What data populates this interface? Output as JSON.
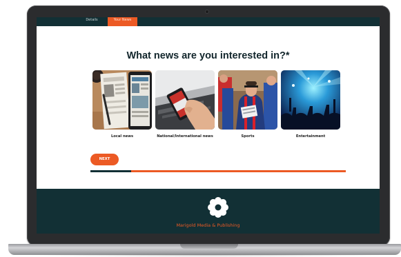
{
  "nav": {
    "item_1": "Details",
    "item_2": "Your News"
  },
  "form": {
    "question": "What news are you interested in?*",
    "options": [
      {
        "label": "Local news",
        "image": "newspapers-photo"
      },
      {
        "label": "National/International news",
        "image": "phone-news-photo"
      },
      {
        "label": "Sports",
        "image": "sports-coach-photo"
      },
      {
        "label": "Entertainment",
        "image": "concert-crowd-photo"
      }
    ],
    "next_label": "NEXT",
    "progress": 0.16
  },
  "footer": {
    "brand": "Marigold Media & Publishing",
    "logo_icon": "marigold-flower-icon"
  },
  "colors": {
    "accent": "#ec5a24",
    "dark": "#123035",
    "text": "#12262c"
  }
}
